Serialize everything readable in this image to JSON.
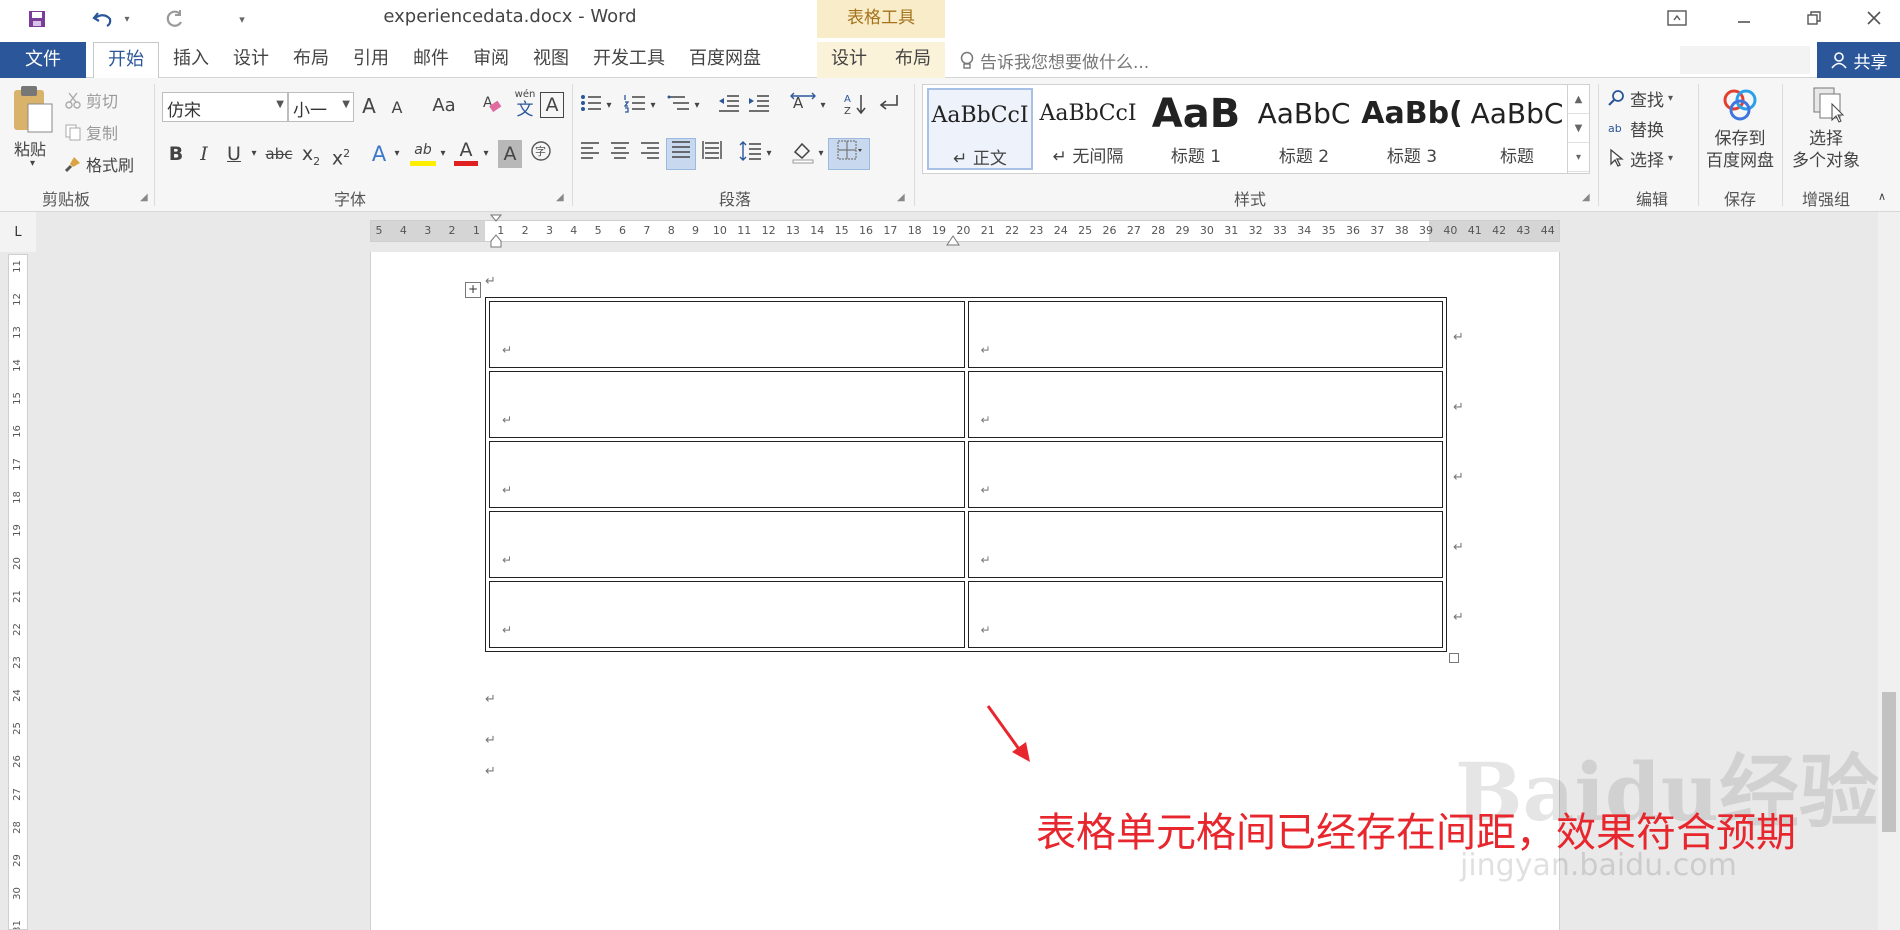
{
  "app": {
    "title": "experiencedata.docx - Word",
    "context_tab_group": "表格工具",
    "accent_color": "#2b579a",
    "context_color": "#a6721e"
  },
  "tabs": {
    "file": "文件",
    "items": [
      "开始",
      "插入",
      "设计",
      "布局",
      "引用",
      "邮件",
      "审阅",
      "视图",
      "开发工具",
      "百度网盘"
    ],
    "context_items": [
      "设计",
      "布局"
    ],
    "active": "开始",
    "tell_me": "告诉我您想要做什么...",
    "share": "共享"
  },
  "ribbon": {
    "clipboard": {
      "label": "剪贴板",
      "paste": "粘贴",
      "cut": "剪切",
      "copy": "复制",
      "format_painter": "格式刷"
    },
    "font": {
      "label": "字体",
      "font_name": "仿宋",
      "font_size": "小一",
      "grow": "A",
      "shrink": "A",
      "case": "Aa",
      "phonetic": "wén",
      "phonetic_char": "文",
      "border_char": "A",
      "bold": "B",
      "italic": "I",
      "underline": "U",
      "strike": "abc",
      "subscript": "x",
      "superscript": "x",
      "sub_num": "2",
      "sup_num": "2",
      "effects": "A",
      "highlight": "ab",
      "color": "A",
      "shade": "A",
      "enclose": "字"
    },
    "paragraph": {
      "label": "段落"
    },
    "styles": {
      "label": "样式",
      "items": [
        {
          "sample": "AaBbCcI",
          "name": "正文"
        },
        {
          "sample": "AaBbCcI",
          "name": "无间隔"
        },
        {
          "sample": "AaB",
          "name": "标题 1"
        },
        {
          "sample": "AaBbC",
          "name": "标题 2"
        },
        {
          "sample": "AaBb(",
          "name": "标题 3"
        },
        {
          "sample": "AaBbC",
          "name": "标题"
        }
      ]
    },
    "editing": {
      "label": "编辑",
      "find": "查找",
      "replace": "替换",
      "select": "选择",
      "replace_icon_text": "ab"
    },
    "save": {
      "label": "保存",
      "button_line1": "保存到",
      "button_line2": "百度网盘"
    },
    "enhance": {
      "label": "增强组",
      "button_line1": "选择",
      "button_line2": "多个对象"
    }
  },
  "ruler": {
    "corner": "L",
    "h_ticks": [
      "5",
      "4",
      "3",
      "2",
      "1",
      "1",
      "2",
      "3",
      "4",
      "5",
      "6",
      "7",
      "8",
      "9",
      "10",
      "11",
      "12",
      "13",
      "14",
      "15",
      "16",
      "17",
      "18",
      "19",
      "20",
      "21",
      "22",
      "23",
      "24",
      "25",
      "26",
      "27",
      "28",
      "29",
      "30",
      "31",
      "32",
      "33",
      "34",
      "35",
      "36",
      "37",
      "38",
      "39",
      "40",
      "41",
      "42",
      "43",
      "44"
    ],
    "v_ticks": [
      "11",
      "12",
      "13",
      "14",
      "15",
      "16",
      "17",
      "18",
      "19",
      "20",
      "21",
      "22",
      "23",
      "24",
      "25",
      "26",
      "27",
      "28",
      "29",
      "30",
      "31"
    ]
  },
  "document": {
    "table": {
      "rows": 5,
      "cols": 2,
      "cell_mark": "↵"
    },
    "para_mark": "↵",
    "move_handle": "+"
  },
  "annotation": {
    "text": "表格单元格间已经存在间距，效果符合预期",
    "color": "#e8262d",
    "watermark": "Baidu经验",
    "watermark_sub": "jingyan.baidu.com"
  }
}
